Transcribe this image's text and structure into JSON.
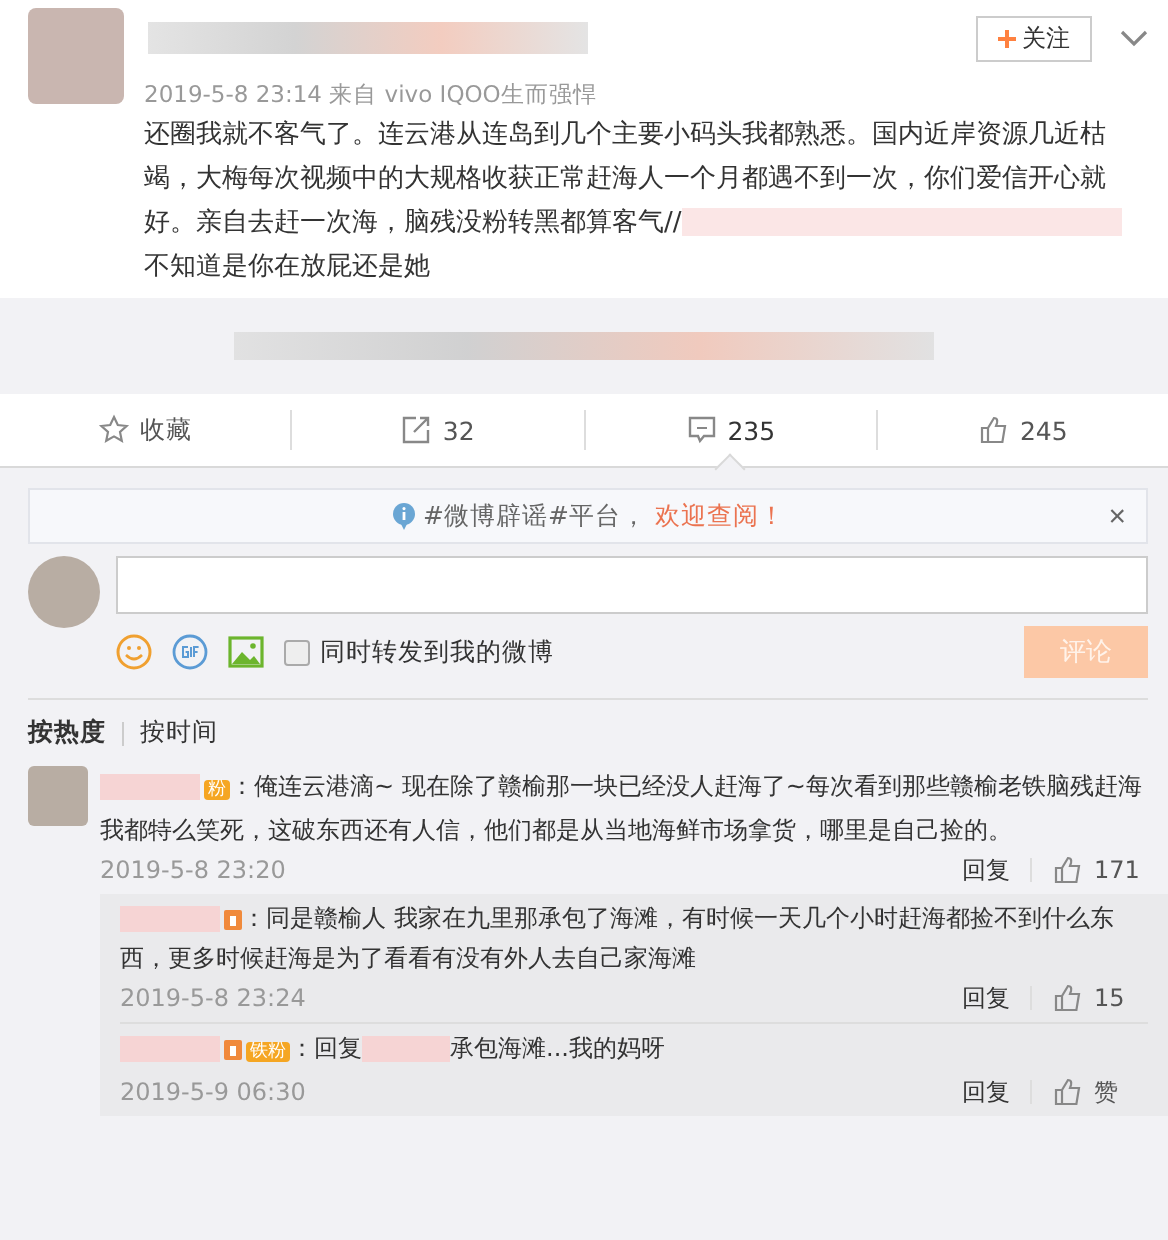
{
  "post": {
    "follow_label": "关注",
    "source": "2019-5-8 23:14 来自 vivo IQOO生而强悍",
    "body_before": "还圈我就不客气了。连云港从连岛到几个主要小码头我都熟悉。国内近岸资源几近枯竭，大梅每次视频中的大规格收获正常赶海人一个月都遇不到一次，你们爱信开心就好。亲自去赶一次海，脑残没粉转黑都算客气//",
    "body_after": "不知道是你在放屁还是她"
  },
  "actions": [
    {
      "kind": "favorite",
      "label": "收藏",
      "selected": false
    },
    {
      "kind": "repost",
      "label": "32",
      "selected": false
    },
    {
      "kind": "comment",
      "label": "235",
      "selected": true
    },
    {
      "kind": "like",
      "label": "245",
      "selected": false
    }
  ],
  "notice": {
    "text": "#微博辟谣#平台，",
    "link": "欢迎查阅！",
    "close": "×"
  },
  "composer": {
    "checkbox_label": "同时转发到我的微博",
    "checked": false,
    "submit": "评论",
    "disabled": true
  },
  "sort_tabs": [
    {
      "label": "按热度",
      "selected": true
    },
    {
      "label": "按时间",
      "selected": false
    }
  ],
  "comments": [
    {
      "badge": "粉",
      "text_before": "：俺连云港滴~ 现在除了赣榆那一块已经没人赶海了~每次看到那些赣榆老铁脑残赶海我都特么笑死，这破东西还有人信，他们都是从当地海鲜市场拿货，哪里是自己捡的。",
      "time": "2019-5-8 23:20",
      "reply": "回复",
      "likes": "171",
      "replies": [
        {
          "text_before": "：同是赣榆人 我家在九里那承包了海滩，有时候一天几个小时赶海都捡不到什么东西，更多时候赶海是为了看看有没有外人去自己家海滩",
          "time": "2019-5-8 23:24",
          "reply": "回复",
          "likes": "15"
        },
        {
          "badge": "铁粉",
          "text_before": "：回复",
          "text_after": "承包海滩...我的妈呀",
          "time": "2019-5-9 06:30",
          "reply": "回复",
          "likes": "赞"
        }
      ]
    }
  ]
}
